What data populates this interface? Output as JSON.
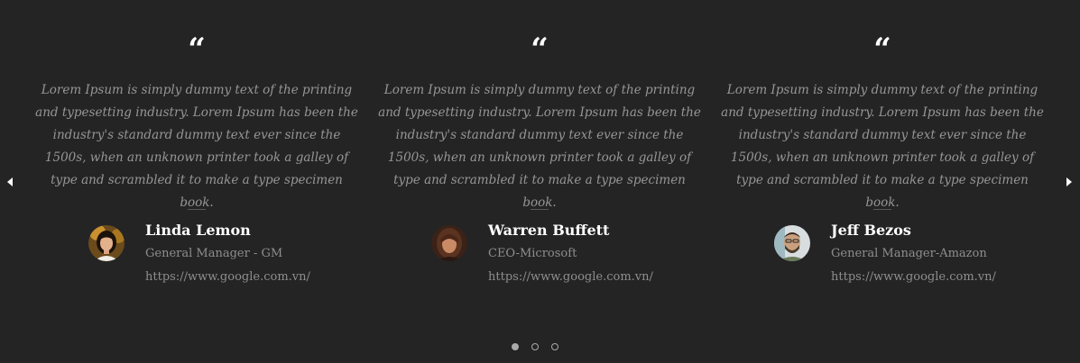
{
  "testimonials": [
    {
      "quote_icon": "quote-icon",
      "quote_mark": "“",
      "text": "Lorem Ipsum is simply dummy text of the printing and typesetting industry. Lorem Ipsum has been the industry's standard dummy text ever since the 1500s, when an unknown printer took a galley of type and scrambled it to make a type specimen book.",
      "name": "Linda Lemon",
      "role": "General Manager - GM",
      "link": "https://www.google.com.vn/"
    },
    {
      "quote_icon": "quote-icon",
      "quote_mark": "“",
      "text": "Lorem Ipsum is simply dummy text of the printing and typesetting industry. Lorem Ipsum has been the industry's standard dummy text ever since the 1500s, when an unknown printer took a galley of type and scrambled it to make a type specimen book.",
      "name": "Warren Buffett",
      "role": "CEO-Microsoft",
      "link": "https://www.google.com.vn/"
    },
    {
      "quote_icon": "quote-icon",
      "quote_mark": "“",
      "text": "Lorem Ipsum is simply dummy text of the printing and typesetting industry. Lorem Ipsum has been the industry's standard dummy text ever since the 1500s, when an unknown printer took a galley of type and scrambled it to make a type specimen book.",
      "name": "Jeff Bezos",
      "role": "General Manager-Amazon",
      "link": "https://www.google.com.vn/"
    }
  ],
  "navigation": {
    "prev_icon": "chevron-left-icon",
    "next_icon": "chevron-right-icon"
  },
  "pagination": {
    "total": 3,
    "active_index": 0
  },
  "colors": {
    "background": "#242424",
    "name_text": "#ffffff",
    "body_text": "#969696",
    "dot": "#aaaaaa"
  }
}
